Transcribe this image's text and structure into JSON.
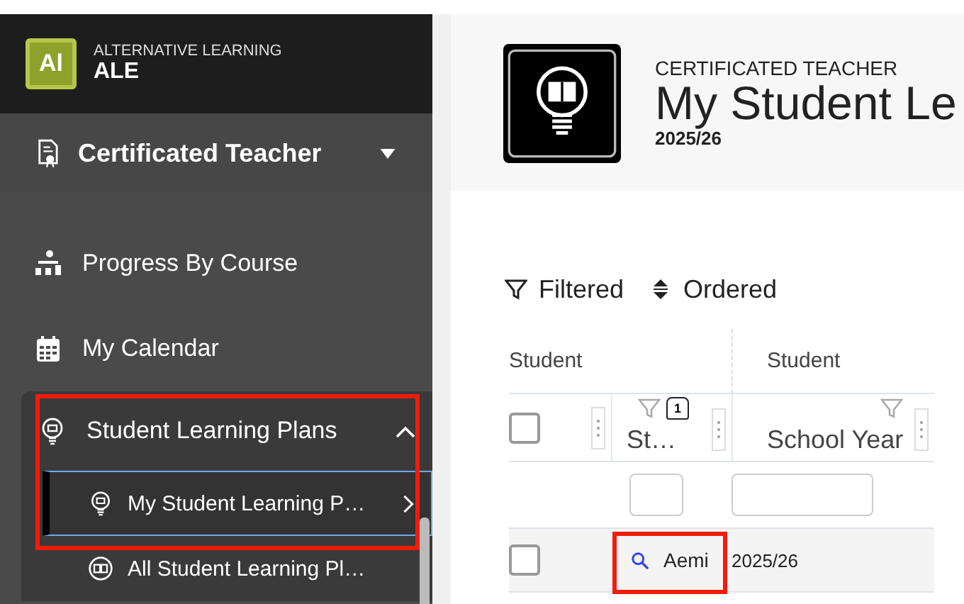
{
  "app": {
    "logo": "Al",
    "subtitle": "ALTERNATIVE LEARNING",
    "title": "ALE"
  },
  "role": {
    "label": "Certificated Teacher",
    "expanded": false
  },
  "sidebar": {
    "items": [
      {
        "kind": "link",
        "label": "Progress By Course"
      },
      {
        "kind": "link",
        "label": "My Calendar"
      },
      {
        "kind": "group",
        "label": "Student Learning Plans",
        "expanded": true,
        "highlighted": true,
        "children": [
          {
            "label": "My Student Learning P…",
            "selected": true
          },
          {
            "label": "All Student Learning Pl…",
            "selected": false
          }
        ]
      }
    ]
  },
  "page": {
    "eyebrow": "CERTIFICATED TEACHER",
    "title": "My Student Le",
    "year": "2025/26"
  },
  "toolbar": [
    {
      "kind": "filter",
      "label": "Filtered"
    },
    {
      "kind": "order",
      "label": "Ordered"
    }
  ],
  "table": {
    "groups": [
      "Student",
      "Student"
    ],
    "all_checked": false,
    "columns": [
      {
        "label": "St…",
        "sort_order": "1"
      },
      {
        "label": "School Year"
      }
    ],
    "rows": [
      {
        "checked": false,
        "student": "Aemi",
        "highlighted": true,
        "school_year": "2025/26"
      }
    ]
  }
}
